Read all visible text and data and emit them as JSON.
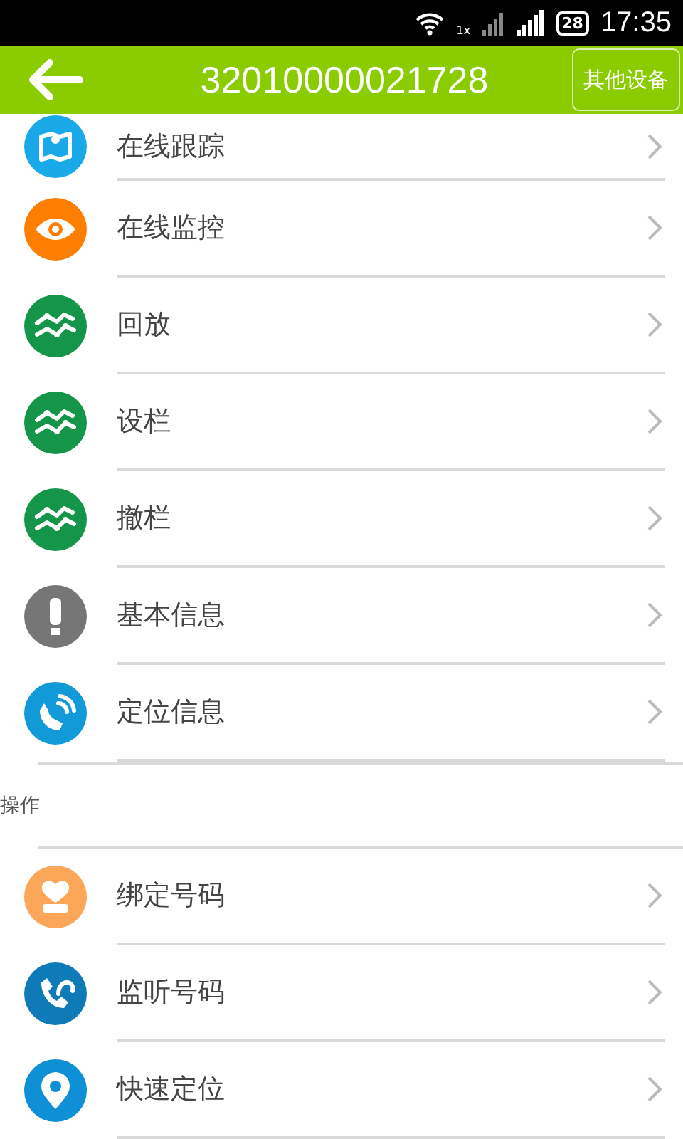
{
  "status_bar": {
    "network": "1x",
    "battery": "28",
    "time": "17:35"
  },
  "header": {
    "title": "32010000021728",
    "button": "其他设备"
  },
  "groups": [
    {
      "items": [
        {
          "label": "在线跟踪",
          "kind": "map",
          "color": "#1aa9e8"
        },
        {
          "label": "在线监控",
          "kind": "eye",
          "color": "#fe7f00"
        },
        {
          "label": "回放",
          "kind": "track",
          "color": "#15954a"
        },
        {
          "label": "设栏",
          "kind": "track",
          "color": "#15954a"
        },
        {
          "label": "撤栏",
          "kind": "track",
          "color": "#15954a"
        },
        {
          "label": "基本信息",
          "kind": "alert",
          "color": "#767676"
        },
        {
          "label": "定位信息",
          "kind": "signal",
          "color": "#129ad8"
        }
      ]
    },
    {
      "title": "操作",
      "items": [
        {
          "label": "绑定号码",
          "kind": "heart",
          "color": "#fca65a"
        },
        {
          "label": "监听号码",
          "kind": "ear",
          "color": "#0e7ab8"
        },
        {
          "label": "快速定位",
          "kind": "pin",
          "color": "#0f90d6"
        }
      ]
    }
  ]
}
